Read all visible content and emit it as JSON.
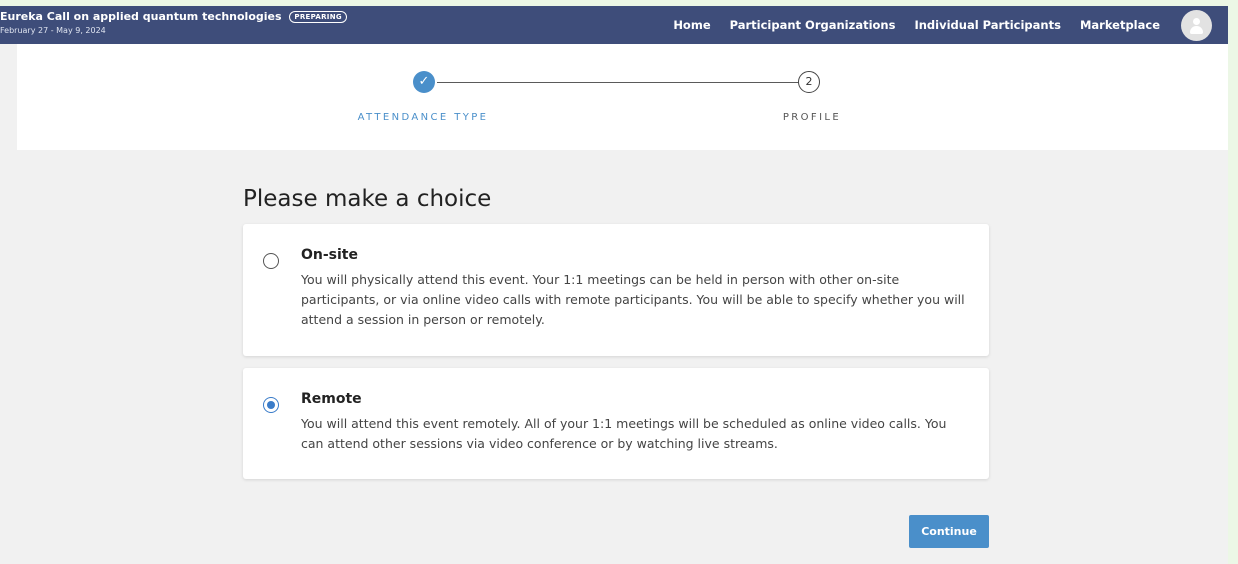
{
  "event": {
    "title": "Eureka Call on applied quantum technologies",
    "status_badge": "PREPARING",
    "dates": "February 27 - May 9, 2024"
  },
  "nav": {
    "items": [
      "Home",
      "Participant Organizations",
      "Individual Participants",
      "Marketplace"
    ]
  },
  "stepper": {
    "steps": [
      {
        "label": "ATTENDANCE TYPE",
        "state": "completed",
        "icon": "check-icon"
      },
      {
        "label": "PROFILE",
        "number": "2",
        "state": "upcoming"
      }
    ]
  },
  "main": {
    "heading": "Please make a choice",
    "options": [
      {
        "title": "On-site",
        "description": "You will physically attend this event. Your 1:1 meetings can be held in person with other on-site participants, or via online video calls with remote participants. You will be able to specify whether you will attend a session in person or remotely.",
        "selected": false
      },
      {
        "title": "Remote",
        "description": "You will attend this event remotely. All of your 1:1 meetings will be scheduled as online video calls. You can attend other sessions via video conference or by watching live streams.",
        "selected": true
      }
    ],
    "continue_label": "Continue"
  },
  "colors": {
    "topbar": "#3e4d7a",
    "accent": "#4a8fca",
    "page_background": "#f1f1f1"
  }
}
